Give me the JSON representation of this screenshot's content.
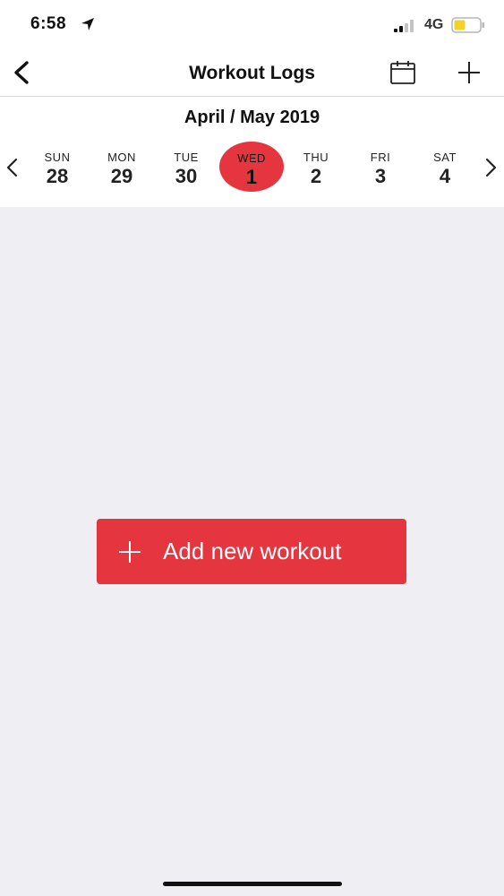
{
  "status_bar": {
    "time": "6:58",
    "network": "4G",
    "icons": [
      "location-arrow-icon",
      "signal-bars-icon",
      "battery-icon"
    ],
    "battery_color": "#f1d12a"
  },
  "nav": {
    "title": "Workout Logs",
    "icons": [
      "back-chevron-icon",
      "calendar-icon",
      "plus-icon"
    ]
  },
  "week": {
    "month_label": "April / May 2019",
    "days": [
      {
        "dow": "SUN",
        "num": "28"
      },
      {
        "dow": "MON",
        "num": "29"
      },
      {
        "dow": "TUE",
        "num": "30"
      },
      {
        "dow": "WED",
        "num": "1",
        "selected": true
      },
      {
        "dow": "THU",
        "num": "2"
      },
      {
        "dow": "FRI",
        "num": "3"
      },
      {
        "dow": "SAT",
        "num": "4"
      }
    ],
    "icons": [
      "chevron-left-icon",
      "chevron-right-icon"
    ]
  },
  "main": {
    "add_workout_label": "Add new workout"
  },
  "colors": {
    "accent": "#e5363f",
    "background": "#efeef2",
    "surface": "#ffffff"
  }
}
